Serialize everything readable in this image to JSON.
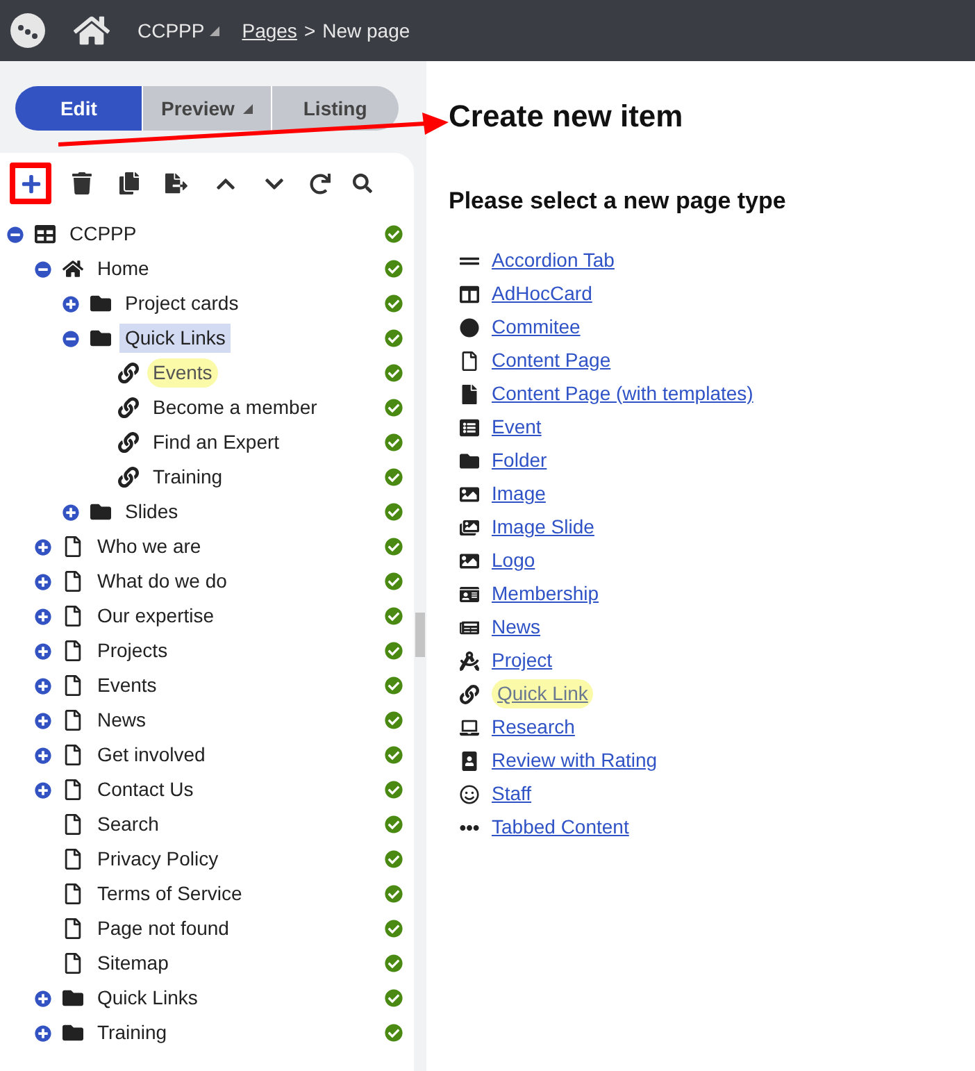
{
  "header": {
    "site": "CCPPP",
    "breadcrumb_link": "Pages",
    "breadcrumb_separator": ">",
    "current": "New page"
  },
  "tabs": [
    {
      "label": "Edit",
      "selected": true,
      "dropdown": false
    },
    {
      "label": "Preview",
      "selected": false,
      "dropdown": true
    },
    {
      "label": "Listing",
      "selected": false,
      "dropdown": false
    }
  ],
  "tree": [
    {
      "label": "CCPPP",
      "kind": "site",
      "expanded": true,
      "selected": false,
      "highlighted": false,
      "children": [
        {
          "label": "Home",
          "kind": "home",
          "expanded": true,
          "selected": false,
          "highlighted": false,
          "children": [
            {
              "label": "Project cards",
              "kind": "folder",
              "expanded": false,
              "selected": false,
              "highlighted": false
            },
            {
              "label": "Quick Links",
              "kind": "folder",
              "expanded": true,
              "selected": true,
              "highlighted": false,
              "children": [
                {
                  "label": "Events",
                  "kind": "link",
                  "selected": false,
                  "highlighted": true
                },
                {
                  "label": "Become a member",
                  "kind": "link",
                  "selected": false,
                  "highlighted": false
                },
                {
                  "label": "Find an Expert",
                  "kind": "link",
                  "selected": false,
                  "highlighted": false
                },
                {
                  "label": "Training",
                  "kind": "link",
                  "selected": false,
                  "highlighted": false
                }
              ]
            },
            {
              "label": "Slides",
              "kind": "folder",
              "expanded": false,
              "selected": false,
              "highlighted": false
            }
          ]
        },
        {
          "label": "Who we are",
          "kind": "page",
          "expanded": false,
          "selected": false,
          "highlighted": false
        },
        {
          "label": "What do we do",
          "kind": "page",
          "expanded": false,
          "selected": false,
          "highlighted": false
        },
        {
          "label": "Our expertise",
          "kind": "page",
          "expanded": false,
          "selected": false,
          "highlighted": false
        },
        {
          "label": "Projects",
          "kind": "page",
          "expanded": false,
          "selected": false,
          "highlighted": false
        },
        {
          "label": "Events",
          "kind": "page",
          "expanded": false,
          "selected": false,
          "highlighted": false
        },
        {
          "label": "News",
          "kind": "page",
          "expanded": false,
          "selected": false,
          "highlighted": false
        },
        {
          "label": "Get involved",
          "kind": "page",
          "expanded": false,
          "selected": false,
          "highlighted": false
        },
        {
          "label": "Contact Us",
          "kind": "page",
          "expanded": false,
          "selected": false,
          "highlighted": false
        },
        {
          "label": "Search",
          "kind": "page",
          "selected": false,
          "highlighted": false
        },
        {
          "label": "Privacy Policy",
          "kind": "page",
          "selected": false,
          "highlighted": false
        },
        {
          "label": "Terms of Service",
          "kind": "page",
          "selected": false,
          "highlighted": false
        },
        {
          "label": "Page not found",
          "kind": "page",
          "selected": false,
          "highlighted": false
        },
        {
          "label": "Sitemap",
          "kind": "page",
          "selected": false,
          "highlighted": false
        },
        {
          "label": "Quick Links",
          "kind": "folder",
          "expanded": false,
          "selected": false,
          "highlighted": false
        },
        {
          "label": "Training",
          "kind": "folder",
          "expanded": false,
          "selected": false,
          "highlighted": false
        }
      ]
    }
  ],
  "content": {
    "title": "Create new item",
    "subtitle": "Please select a new page type",
    "page_types": [
      {
        "label": "Accordion Tab",
        "highlighted": false
      },
      {
        "label": "AdHocCard",
        "highlighted": false
      },
      {
        "label": "Commitee",
        "highlighted": false
      },
      {
        "label": "Content Page",
        "highlighted": false
      },
      {
        "label": "Content Page (with templates)",
        "highlighted": false
      },
      {
        "label": "Event",
        "highlighted": false
      },
      {
        "label": "Folder",
        "highlighted": false
      },
      {
        "label": "Image",
        "highlighted": false
      },
      {
        "label": "Image Slide",
        "highlighted": false
      },
      {
        "label": "Logo",
        "highlighted": false
      },
      {
        "label": "Membership",
        "highlighted": false
      },
      {
        "label": "News",
        "highlighted": false
      },
      {
        "label": "Project",
        "highlighted": false
      },
      {
        "label": "Quick Link",
        "highlighted": true
      },
      {
        "label": "Research",
        "highlighted": false
      },
      {
        "label": "Review with Rating",
        "highlighted": false
      },
      {
        "label": "Staff",
        "highlighted": false
      },
      {
        "label": "Tabbed Content",
        "highlighted": false
      }
    ]
  }
}
